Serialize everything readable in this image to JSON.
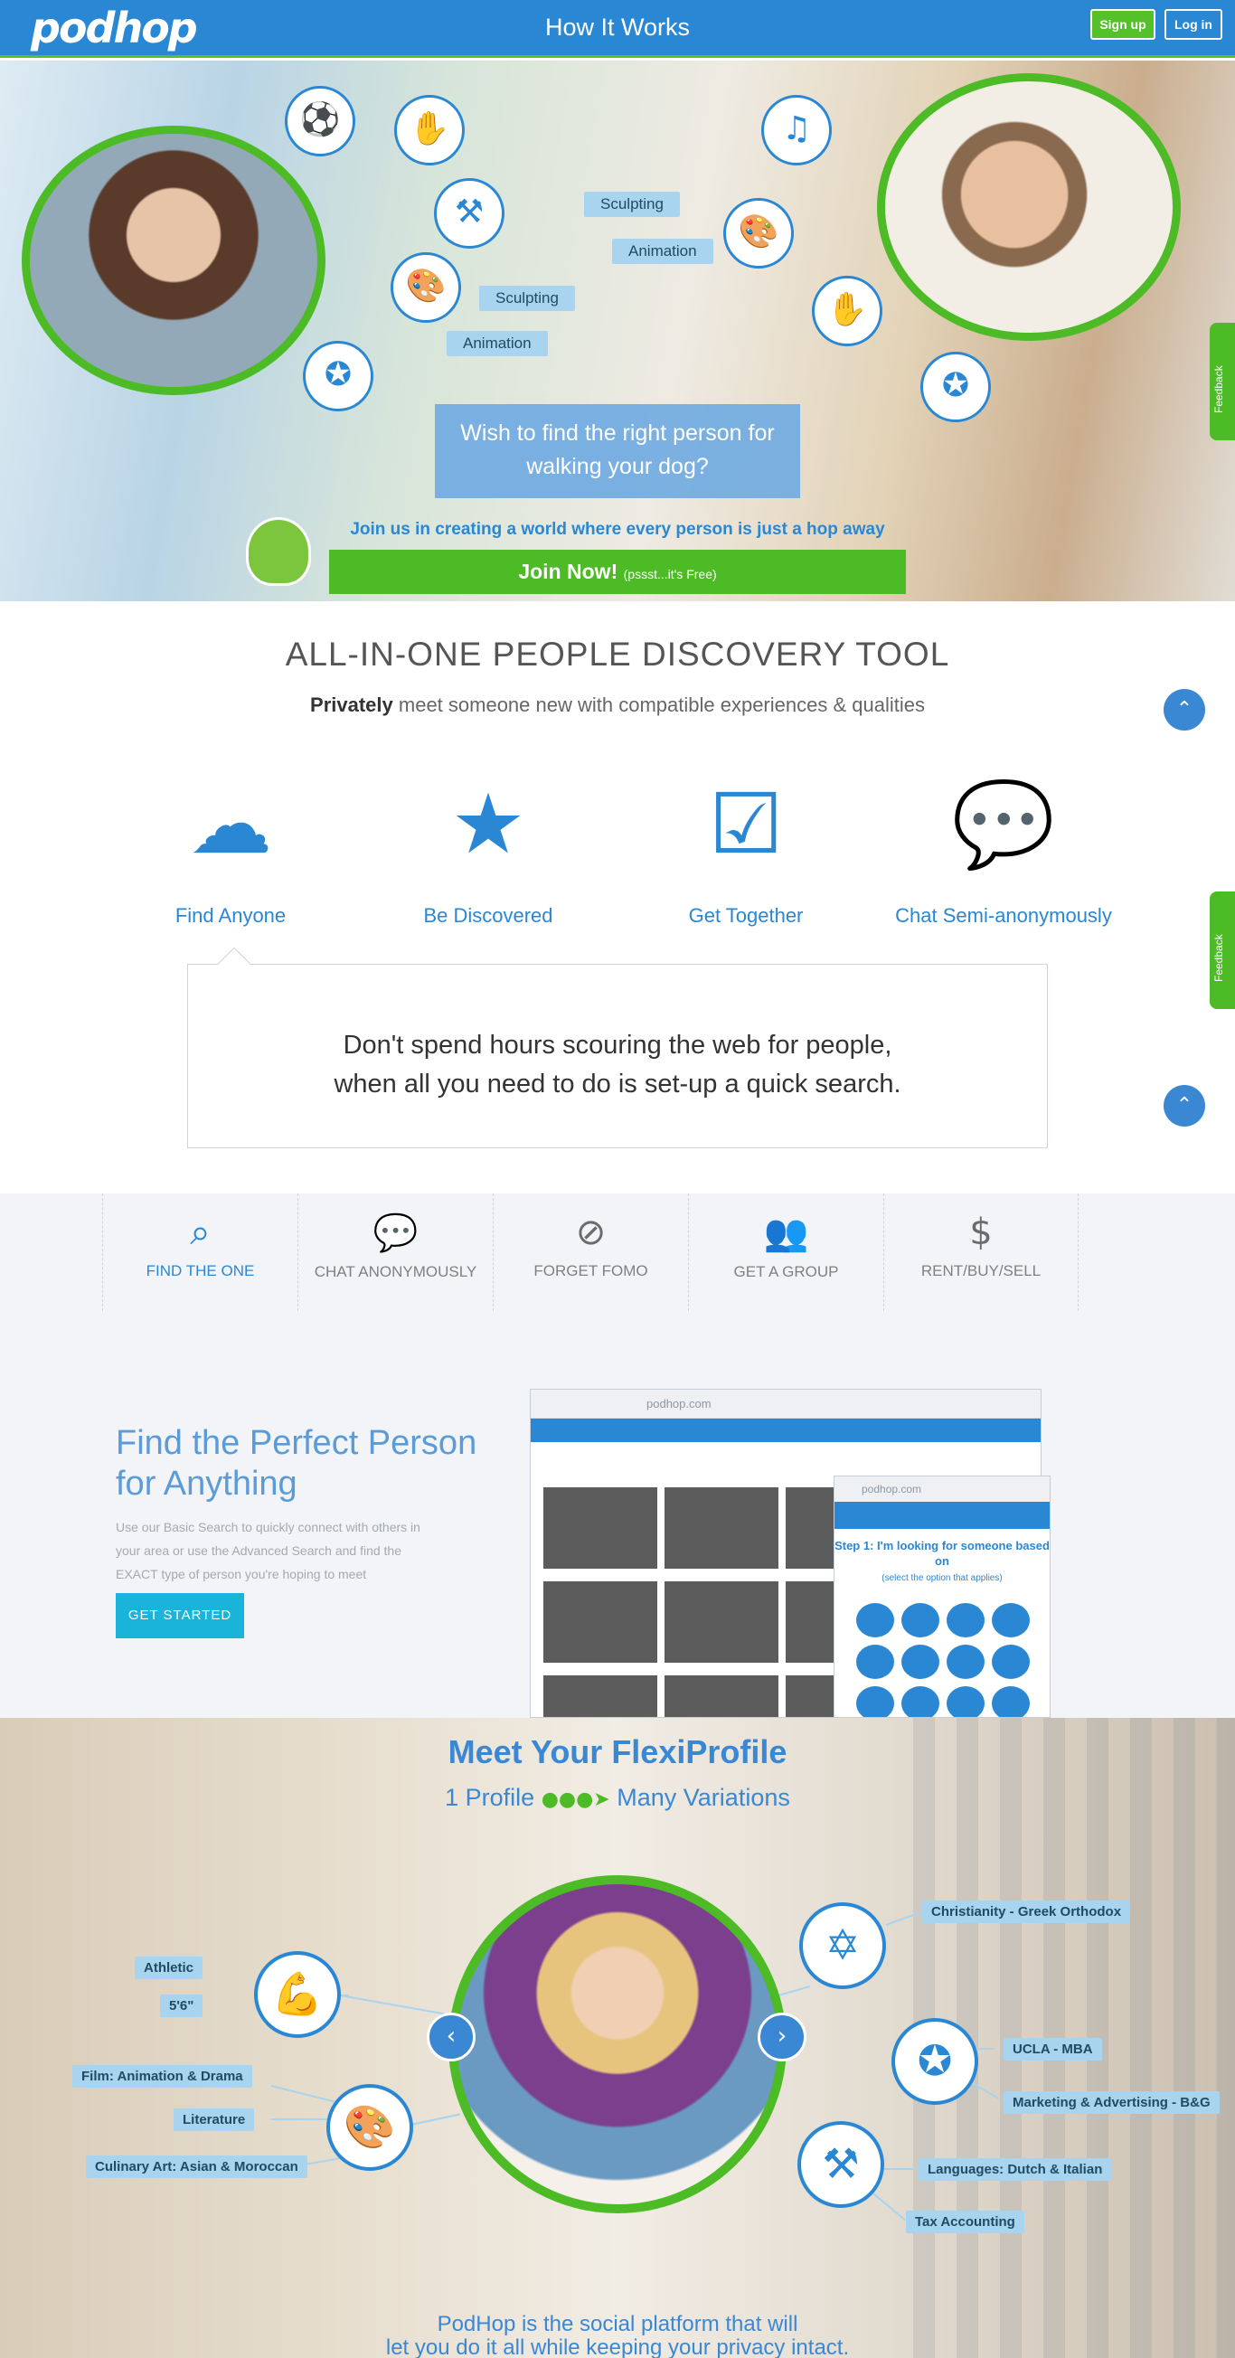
{
  "header": {
    "logo_text": "podhop",
    "title": "How It Works",
    "signup_label": "Sign up",
    "login_label": "Log in"
  },
  "hero": {
    "tags_left": [
      "Sculpting",
      "Animation"
    ],
    "tags_right": [
      "Sculpting",
      "Animation"
    ],
    "question": "Wish to find the right person for walking your dog?",
    "tagline": "Join us in creating a world where every person is just a hop away",
    "join_label": "Join Now!",
    "join_small": "(pssst...it's Free)"
  },
  "feedback_label": "Feedback",
  "tool": {
    "title": "ALL-IN-ONE PEOPLE DISCOVERY TOOL",
    "subtitle_bold": "Privately",
    "subtitle_rest": " meet someone new with compatible experiences & qualities",
    "features": [
      {
        "label": "Find Anyone",
        "icon": "cloud-search-icon"
      },
      {
        "label": "Be Discovered",
        "icon": "star-icon"
      },
      {
        "label": "Get Together",
        "icon": "calendar-check-icon"
      },
      {
        "label": "Chat Semi-anonymously",
        "icon": "chat-bubbles-icon"
      }
    ],
    "quote_line1": "Don't spend hours scouring the web for people,",
    "quote_line2": "when all you need to do is set-up a quick search."
  },
  "tabs": [
    {
      "label": "FIND THE ONE",
      "icon": "search-icon",
      "active": true
    },
    {
      "label": "CHAT ANONYMOUSLY",
      "icon": "chat-icon",
      "active": false
    },
    {
      "label": "FORGET FOMO",
      "icon": "ban-icon",
      "active": false
    },
    {
      "label": "GET A GROUP",
      "icon": "group-icon",
      "active": false
    },
    {
      "label": "RENT/BUY/SELL",
      "icon": "dollar-icon",
      "active": false
    }
  ],
  "find": {
    "heading": "Find the Perfect Person for Anything",
    "body": "Use our Basic Search to quickly connect with others in your area or use the Advanced Search and find the EXACT type of person you're hoping to meet",
    "cta": "GET STARTED",
    "browser_url": "podhop.com",
    "mobile_url": "podhop.com",
    "mobile_step": "Step 1: I'm looking for someone based on",
    "mobile_hint": "(select the option that applies)"
  },
  "flexi": {
    "title": "Meet Your FlexiProfile",
    "sub_left": "1 Profile",
    "sub_right": "Many Variations",
    "tags": {
      "athletic": "Athletic",
      "height": "5'6\"",
      "film": "Film: Animation & Drama",
      "literature": "Literature",
      "culinary": "Culinary Art: Asian & Moroccan",
      "religion": "Christianity - Greek Orthodox",
      "ucla": "UCLA - MBA",
      "marketing": "Marketing & Advertising - B&G",
      "languages": "Languages: Dutch & Italian",
      "tax": "Tax Accounting"
    },
    "footer_line1": "PodHop is the social platform that will",
    "footer_line2": "let you do it all while keeping your privacy intact."
  }
}
